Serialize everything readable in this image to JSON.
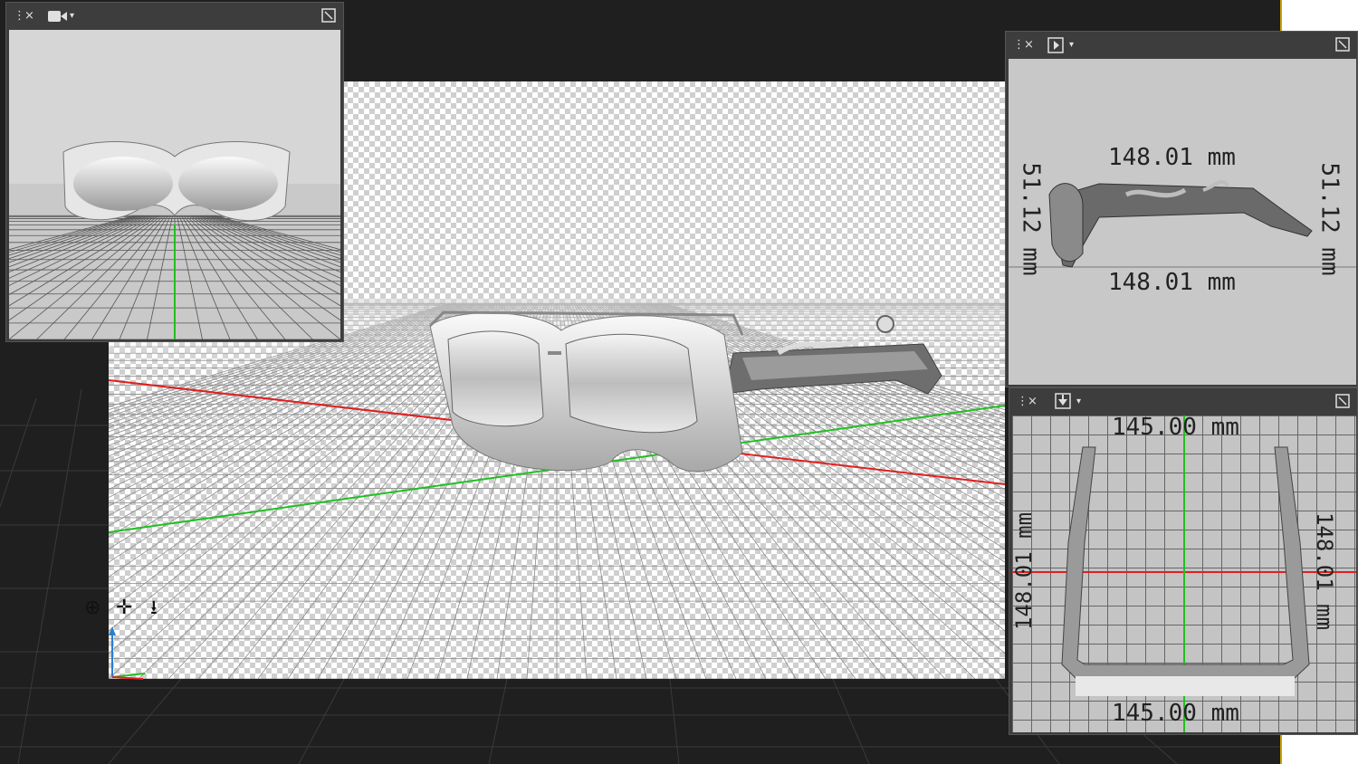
{
  "main_view": {
    "nav_icons": [
      "orbit-icon",
      "pan-icon",
      "dolly-icon"
    ]
  },
  "camera_panel": {
    "close_glyph": "×",
    "menu_glyph": "⋮",
    "camera_icon": "camera-icon",
    "dropdown_glyph": "▾",
    "maximize_icon": "maximize-icon"
  },
  "side_panel": {
    "close_glyph": "×",
    "menu_glyph": "⋮",
    "view_icon": "side-view-icon",
    "dropdown_glyph": "▾",
    "dim_width_top": "148.01 mm",
    "dim_width_bottom": "148.01 mm",
    "dim_height_left": "51.12 mm",
    "dim_height_right": "51.12 mm"
  },
  "top_panel": {
    "close_glyph": "×",
    "menu_glyph": "⋮",
    "view_icon": "top-view-icon",
    "dropdown_glyph": "▾",
    "dim_width_top": "145.00 mm",
    "dim_width_bottom": "145.00 mm",
    "dim_depth_left": "148.01 mm",
    "dim_depth_right": "148.01 mm"
  },
  "colors": {
    "x_axis": "#e02020",
    "y_axis": "#20c020",
    "z_axis": "#2a7fd0",
    "frame_border": "#c9a400"
  }
}
